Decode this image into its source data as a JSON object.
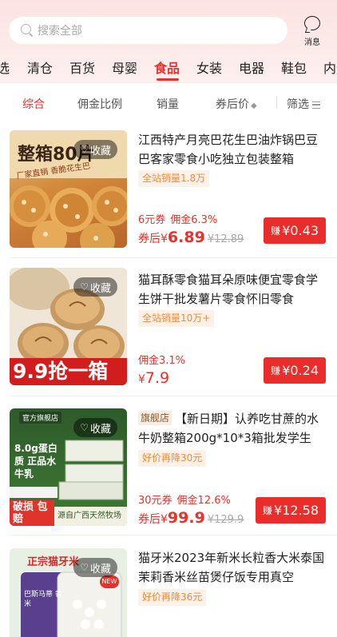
{
  "search": {
    "placeholder": "搜索全部"
  },
  "message": {
    "label": "消息"
  },
  "categories": [
    "选",
    "清仓",
    "百货",
    "母婴",
    "食品",
    "女装",
    "电器",
    "鞋包",
    "内"
  ],
  "active_category": "食品",
  "sort": {
    "options": [
      "综合",
      "佣金比例",
      "销量",
      "券后价"
    ],
    "filter": "筛选",
    "active": "综合"
  },
  "products": [
    {
      "title": "江西特产月亮巴花生巴油炸锅巴豆巴客家零食小吃独立包装整箱",
      "tag": "全站销量1.8万",
      "coupon": "6元券",
      "commission": "佣金6.3%",
      "price_prefix": "券后",
      "currency": "¥",
      "price": "6.89",
      "original": "¥12.89",
      "earn_prefix": "赚",
      "earn": "¥0.43",
      "fav": "收藏",
      "image_text": "整箱80片",
      "image_sub": "厂家直销 香脆花生巴"
    },
    {
      "title": "猫耳酥零食猫耳朵原味便宜零食学生饼干批发薯片零食怀旧零食",
      "tag": "全站销量10万+",
      "coupon": "",
      "commission": "佣金3.1%",
      "price_prefix": "",
      "currency": "¥",
      "price": "7.9",
      "original": "",
      "earn_prefix": "赚",
      "earn": "¥0.24",
      "fav": "收藏",
      "image_text": "9.9抢一箱"
    },
    {
      "shop_tag": "旗舰店",
      "title": "【新日期】认养吃甘蔗的水牛奶整箱200g*10*3箱批发学生",
      "tag": "好价再降30元",
      "coupon": "30元券",
      "commission": "佣金12.6%",
      "price_prefix": "券后",
      "currency": "¥",
      "price": "99.9",
      "original": "¥129.9",
      "earn_prefix": "赚",
      "earn": "¥12.58",
      "fav": "收藏",
      "image_badge": "官方旗舰店",
      "image_text": "8.0g蛋白质 正品水牛乳",
      "image_bottom_left": "破损 包赔",
      "image_bottom_right": "源自广西天然牧场"
    },
    {
      "title": "猫牙米2023年新米长粒香大米泰国茉莉香米丝苗煲仔饭专用真空",
      "tag": "好价再降36元",
      "fav": "收藏",
      "image_text": "正宗猫牙米",
      "image_badge": "NEW",
      "image_pack": "巴斯马蒂 香米"
    }
  ],
  "colors": {
    "accent": "#e8322a",
    "tag_orange": "#f08a3a",
    "top_bg": "#fbe3e1"
  }
}
